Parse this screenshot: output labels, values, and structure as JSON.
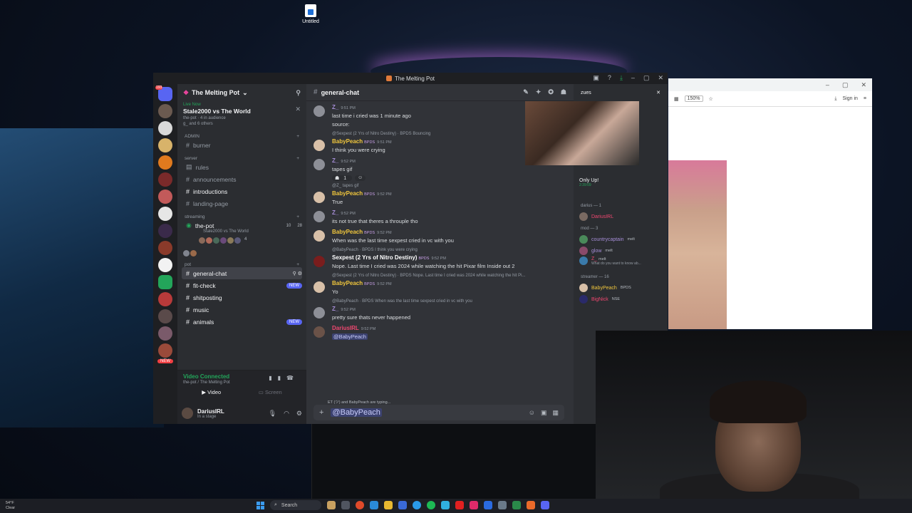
{
  "desktop": {
    "icon_label": "Untitled"
  },
  "browser": {
    "zoom": "150%",
    "sign_in": "Sign in"
  },
  "window": {
    "title": "The Melting Pot"
  },
  "server": {
    "name": "The Melting Pot",
    "live_label": "Live Now",
    "live_title": "Stale2000 vs The World",
    "live_sub1": "the-pot · 4 in audience",
    "live_sub2": "g_ and 6 others",
    "categories": {
      "admin": "ADMIN",
      "server": "server",
      "streaming": "streaming",
      "pot": "pot"
    },
    "channels": {
      "burner": "burner",
      "rules": "rules",
      "announcements": "announcements",
      "introductions": "introductions",
      "landing": "landing-page",
      "the_pot": "the-pot",
      "the_pot_sub": "Stale2000 vs The World",
      "the_pot_count": "10",
      "the_pot_count2": "28",
      "audience_count": "4",
      "general": "general-chat",
      "fit": "fit-check",
      "shit": "shitposting",
      "music": "music",
      "animals": "animals",
      "new_label": "NEW"
    },
    "guild_badge": "193",
    "guild_new": "NEW"
  },
  "voice": {
    "status": "Video Connected",
    "location": "the-pot / The Melting Pot",
    "video": "Video",
    "screen": "Screen"
  },
  "user": {
    "name": "DariusIRL",
    "status": "In a stage"
  },
  "chat": {
    "channel": "general-chat",
    "typing": "ET (ツ) and BabyPeach are typing...",
    "composer_text": "@BabyPeach",
    "messages": [
      {
        "reply": "",
        "author": "Z_",
        "time": "9:51 PM",
        "tag": "",
        "lines": [
          "last time i cried was 1 minute ago",
          "source:"
        ]
      },
      {
        "reply": "@Sexpest (2 Yrs of Nitro Destiny) · BPDS Bouncing",
        "author": "BabyPeach",
        "time": "9:51 PM",
        "tag": "BPDS",
        "lines": [
          "I think you were crying"
        ]
      },
      {
        "reply": "",
        "author": "Z_",
        "time": "9:52 PM",
        "tag": "",
        "lines": [
          "tapes gif"
        ],
        "reaction": "1"
      },
      {
        "reply": "@Z_ tapes gif",
        "author": "BabyPeach",
        "time": "9:52 PM",
        "tag": "BPDS",
        "lines": [
          "True"
        ]
      },
      {
        "reply": "",
        "author": "Z_",
        "time": "9:52 PM",
        "tag": "",
        "lines": [
          "its not true that theres a throuple tho"
        ]
      },
      {
        "reply": "",
        "author": "BabyPeach",
        "time": "9:52 PM",
        "tag": "BPDS",
        "lines": [
          "When was the last time sexpest cried in vc with you"
        ]
      },
      {
        "reply": "@BabyPeach · BPDS I think you were crying",
        "author": "Sexpest (2 Yrs of Nitro Destiny)",
        "time": "9:52 PM",
        "tag": "BPDS",
        "lines": [
          "Nope. Last time I cried was 2024 while watching the hit Pixar film Inside out 2"
        ]
      },
      {
        "reply": "@Sexpest (2 Yrs of Nitro Destiny) · BPDS Nope. Last time I cried was 2024 while watching the hit Pi...",
        "author": "BabyPeach",
        "time": "9:52 PM",
        "tag": "BPDS",
        "lines": [
          "Yo"
        ]
      },
      {
        "reply": "@BabyPeach · BPDS When was the last time sexpest cried in vc with you",
        "author": "Z_",
        "time": "9:52 PM",
        "tag": "",
        "lines": [
          "pretty sure thats never happened"
        ]
      },
      {
        "reply": "",
        "author": "DariusIRL",
        "time": "9:52 PM",
        "tag": "",
        "lines": [
          "@BabyPeach"
        ]
      }
    ]
  },
  "members": {
    "header": "zues",
    "only_up": "Only Up!",
    "only_up_time": "2:39:09",
    "cat_darius": "darius — 1",
    "cat_mod": "mod — 3",
    "cat_streamer": "streamer — 16",
    "list": [
      {
        "name": "DariusIRL",
        "tag": "",
        "color": "#f04770"
      },
      {
        "name": "countrycaptain",
        "tag": "melt",
        "color": "#a58dd6"
      },
      {
        "name": "glow",
        "tag": "melt",
        "color": "#a58dd6"
      },
      {
        "name": "Z_",
        "tag": "melt",
        "color": "#f04770",
        "sub": "What do you want to know ab..."
      },
      {
        "name": "BabyPeach",
        "tag": "BPDS",
        "color": "#f0c63c"
      },
      {
        "name": "BigNick",
        "tag": "NSE",
        "color": "#f04770"
      }
    ]
  },
  "taskbar": {
    "temp": "54°F",
    "weather": "Clear",
    "search": "Search"
  }
}
